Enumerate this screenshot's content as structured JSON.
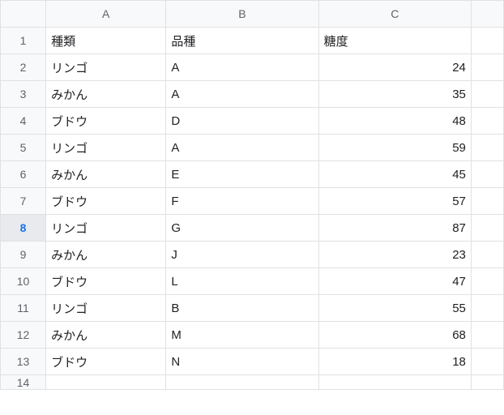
{
  "columns": [
    "A",
    "B",
    "C"
  ],
  "selected_row": 8,
  "headers": {
    "A": "種類",
    "B": "品種",
    "C": "糖度"
  },
  "rows": [
    {
      "n": "1",
      "A": "種類",
      "B": "品種",
      "C": "糖度",
      "Cnum": false
    },
    {
      "n": "2",
      "A": "リンゴ",
      "B": "A",
      "C": "24",
      "Cnum": true
    },
    {
      "n": "3",
      "A": "みかん",
      "B": "A",
      "C": "35",
      "Cnum": true
    },
    {
      "n": "4",
      "A": "ブドウ",
      "B": "D",
      "C": "48",
      "Cnum": true
    },
    {
      "n": "5",
      "A": "リンゴ",
      "B": "A",
      "C": "59",
      "Cnum": true
    },
    {
      "n": "6",
      "A": "みかん",
      "B": "E",
      "C": "45",
      "Cnum": true
    },
    {
      "n": "7",
      "A": "ブドウ",
      "B": "F",
      "C": "57",
      "Cnum": true
    },
    {
      "n": "8",
      "A": "リンゴ",
      "B": "G",
      "C": "87",
      "Cnum": true
    },
    {
      "n": "9",
      "A": "みかん",
      "B": "J",
      "C": "23",
      "Cnum": true
    },
    {
      "n": "10",
      "A": "ブドウ",
      "B": "L",
      "C": "47",
      "Cnum": true
    },
    {
      "n": "11",
      "A": "リンゴ",
      "B": "B",
      "C": "55",
      "Cnum": true
    },
    {
      "n": "12",
      "A": "みかん",
      "B": "M",
      "C": "68",
      "Cnum": true
    },
    {
      "n": "13",
      "A": "ブドウ",
      "B": "N",
      "C": "18",
      "Cnum": true
    },
    {
      "n": "14",
      "A": "",
      "B": "",
      "C": "",
      "Cnum": false
    }
  ]
}
